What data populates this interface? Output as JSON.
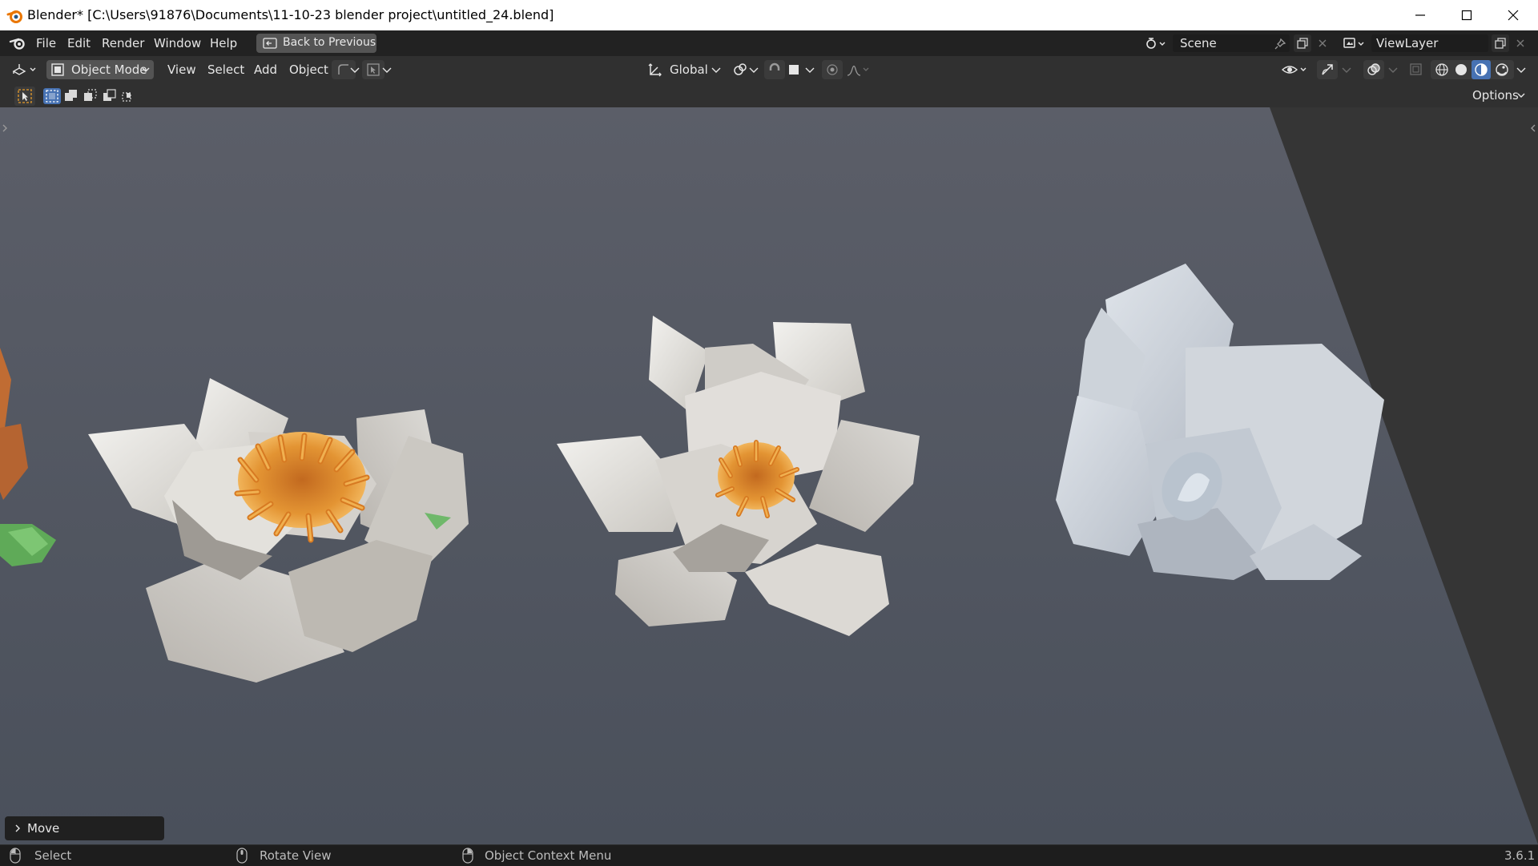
{
  "window": {
    "title": "Blender* [C:\\Users\\91876\\Documents\\11-10-23 blender project\\untitled_24.blend]"
  },
  "topbar": {
    "menus": [
      "File",
      "Edit",
      "Render",
      "Window",
      "Help"
    ],
    "back_button": "Back to Previous",
    "scene": "Scene",
    "view_layer": "ViewLayer"
  },
  "header": {
    "mode": "Object Mode",
    "menus": [
      "View",
      "Select",
      "Add",
      "Object"
    ],
    "transform_orientation": "Global",
    "options": "Options"
  },
  "viewport": {
    "background_top": "#5b5e68",
    "background_bottom": "#4a505b",
    "objects": [
      "lotus-flower-open",
      "lotus-flower-layered",
      "lotus-flower-bud"
    ]
  },
  "operator_panel": {
    "label": "Move"
  },
  "statusbar": {
    "select": "Select",
    "rotate": "Rotate View",
    "context": "Object Context Menu",
    "version": "3.6.1"
  },
  "colors": {
    "accent": "#4772b3",
    "header": "#303030",
    "topbar": "#222222"
  }
}
